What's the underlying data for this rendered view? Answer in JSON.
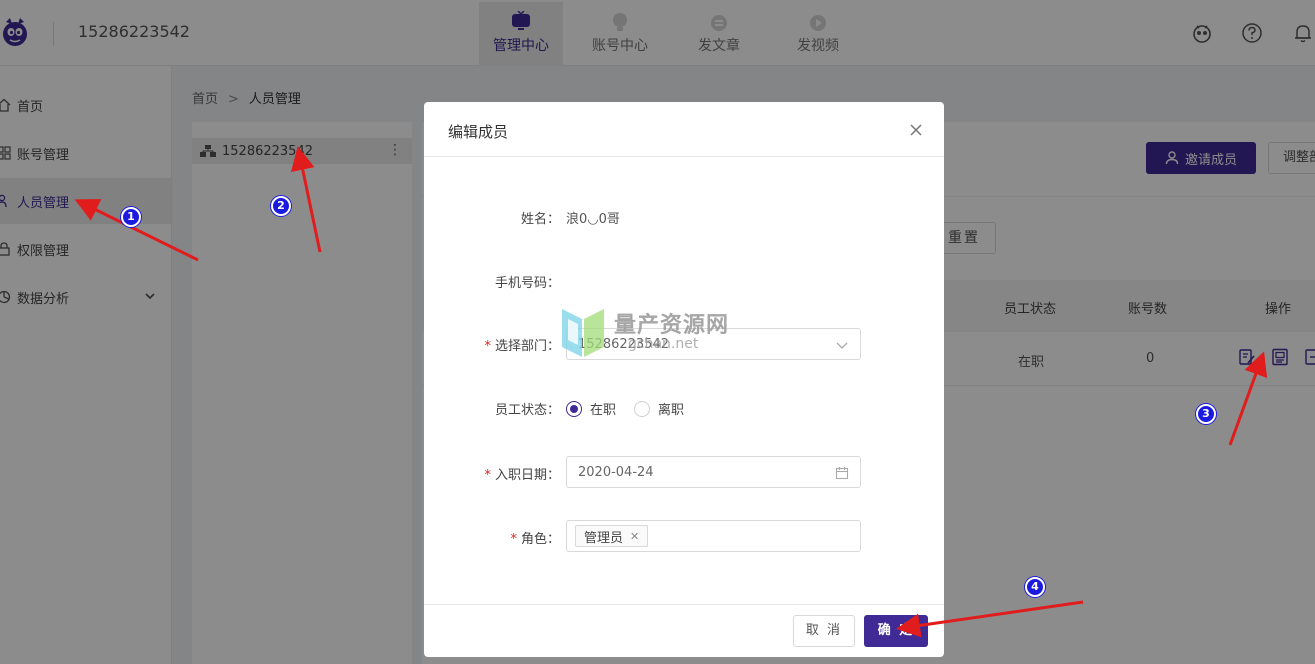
{
  "header": {
    "account": "15286223542",
    "tabs": [
      {
        "label": "管理中心",
        "icon": "monitor-icon",
        "active": true
      },
      {
        "label": "账号中心",
        "icon": "account-center-icon",
        "active": false
      },
      {
        "label": "发文章",
        "icon": "article-icon",
        "active": false
      },
      {
        "label": "发视频",
        "icon": "video-icon",
        "active": false
      }
    ],
    "right_icons": [
      "mascot-icon",
      "help-icon",
      "bell-icon"
    ]
  },
  "sidebar": {
    "items": [
      {
        "label": "首页",
        "icon": "home-icon",
        "active": false
      },
      {
        "label": "账号管理",
        "icon": "grid-icon",
        "active": false
      },
      {
        "label": "人员管理",
        "icon": "users-icon",
        "active": true
      },
      {
        "label": "权限管理",
        "icon": "lock-icon",
        "active": false
      },
      {
        "label": "数据分析",
        "icon": "chart-icon",
        "active": false
      }
    ]
  },
  "breadcrumb": {
    "home": "首页",
    "separator": ">",
    "current": "人员管理"
  },
  "dept_tree": {
    "root": "15286223542"
  },
  "main": {
    "invite_label": "邀请成员",
    "adjust_label": "调整部门",
    "reset_label": "重置",
    "table": {
      "headers": [
        "员工状态",
        "账号数",
        "操作"
      ],
      "rows": [
        {
          "status": "在职",
          "accounts": "0"
        }
      ]
    }
  },
  "modal": {
    "title": "编辑成员",
    "fields": {
      "name_label": "姓名：",
      "name_value": "浪0◡0哥",
      "phone_label": "手机号码：",
      "dept_label": "选择部门：",
      "dept_value": "15286223542",
      "status_label": "员工状态：",
      "status_options": [
        "在职",
        "离职"
      ],
      "status_selected": "在职",
      "date_label": "入职日期：",
      "date_value": "2020-04-24",
      "role_label": "角色：",
      "role_tag": "管理员"
    },
    "required_mark": "*",
    "cancel_label": "取 消",
    "confirm_label": "确 定"
  },
  "watermark": {
    "cn": "量产资源网",
    "en": "gchan.net"
  },
  "annotations": [
    "1",
    "2",
    "3",
    "4"
  ],
  "colors": {
    "primary": "#3f2a96",
    "arrow": "#e01c1c",
    "badge": "#1b1be0"
  }
}
